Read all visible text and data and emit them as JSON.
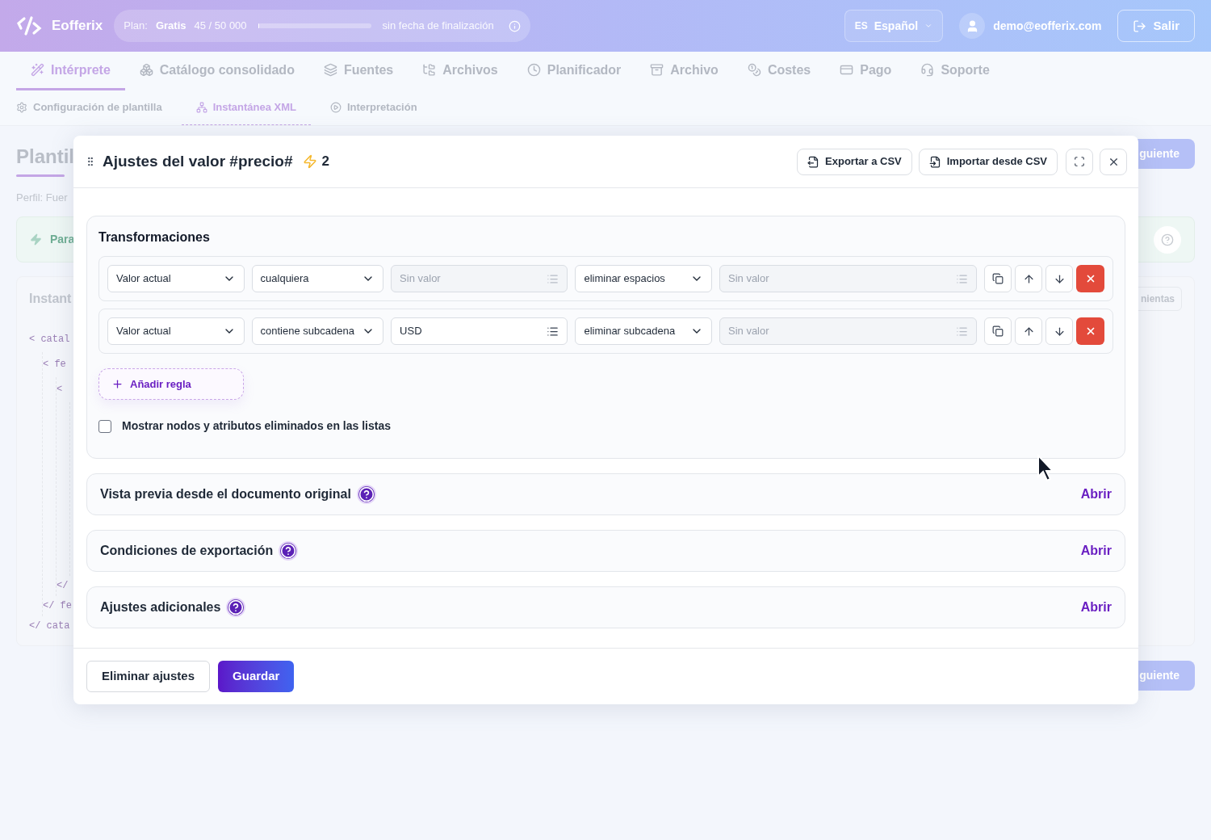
{
  "header": {
    "logo": "Eofferix",
    "plan": {
      "label": "Plan:",
      "name": "Gratis",
      "usage": "45 / 50 000",
      "level": 0.001,
      "end": "sin fecha de finalización"
    },
    "language": {
      "code": "ES",
      "name": "Español"
    },
    "user": "demo@eofferix.com",
    "logout": "Salir"
  },
  "nav_tabs": [
    {
      "label": "Intérprete",
      "selected": true
    },
    {
      "label": "Catálogo consolidado",
      "selected": false
    },
    {
      "label": "Fuentes",
      "selected": false
    },
    {
      "label": "Archivos",
      "selected": false
    },
    {
      "label": "Planificador",
      "selected": false
    },
    {
      "label": "Archivo",
      "selected": false
    },
    {
      "label": "Costes",
      "selected": false
    },
    {
      "label": "Pago",
      "selected": false
    },
    {
      "label": "Soporte",
      "selected": false
    }
  ],
  "sub_tabs": [
    {
      "label": "Configuración de plantilla",
      "selected": false
    },
    {
      "label": "Instantánea XML",
      "selected": true
    },
    {
      "label": "Interpretación",
      "selected": false
    }
  ],
  "background": {
    "title": "Plantil",
    "profile": "Perfil: Fuer",
    "hint": "Para",
    "card_title": "Instant",
    "tools_button": "nientas",
    "next_buttons": [
      "guiente",
      "guiente"
    ],
    "code": [
      {
        "open": "< catal",
        "close": "</ cata",
        "children": [
          {
            "open": "< fe",
            "close": "</ fe",
            "children": [
              {
                "open": "<",
                "close": "</"
              }
            ]
          }
        ]
      }
    ]
  },
  "modal": {
    "title": "Ajustes del valor #precio#",
    "count": "2",
    "header_buttons": [
      "Exportar a CSV",
      "Importar desde CSV"
    ],
    "transformations": {
      "title": "Transformaciones",
      "rules": [
        {
          "source": "Valor actual",
          "condition": "cualquiera",
          "condition_value": {
            "placeholder": "Sin valor",
            "disabled": true
          },
          "action": "eliminar espacios",
          "action_value": {
            "placeholder": "Sin valor",
            "disabled": true
          }
        },
        {
          "source": "Valor actual",
          "condition": "contiene subcadena",
          "condition_value": {
            "value": "USD",
            "disabled": false
          },
          "action": "eliminar subcadena",
          "action_value": {
            "placeholder": "Sin valor",
            "disabled": true
          }
        }
      ],
      "add_rule": "Añadir regla",
      "show_removed": {
        "label": "Mostrar nodos y atributos eliminados en las listas",
        "checked": false
      }
    },
    "sections": [
      {
        "title": "Vista previa desde el documento original",
        "action": "Abrir"
      },
      {
        "title": "Condiciones de exportación",
        "action": "Abrir"
      },
      {
        "title": "Ajustes adicionales",
        "action": "Abrir"
      }
    ],
    "footer_buttons": [
      {
        "label": "Eliminar ajustes",
        "kind": "secondary"
      },
      {
        "label": "Guardar",
        "kind": "primary"
      }
    ]
  }
}
